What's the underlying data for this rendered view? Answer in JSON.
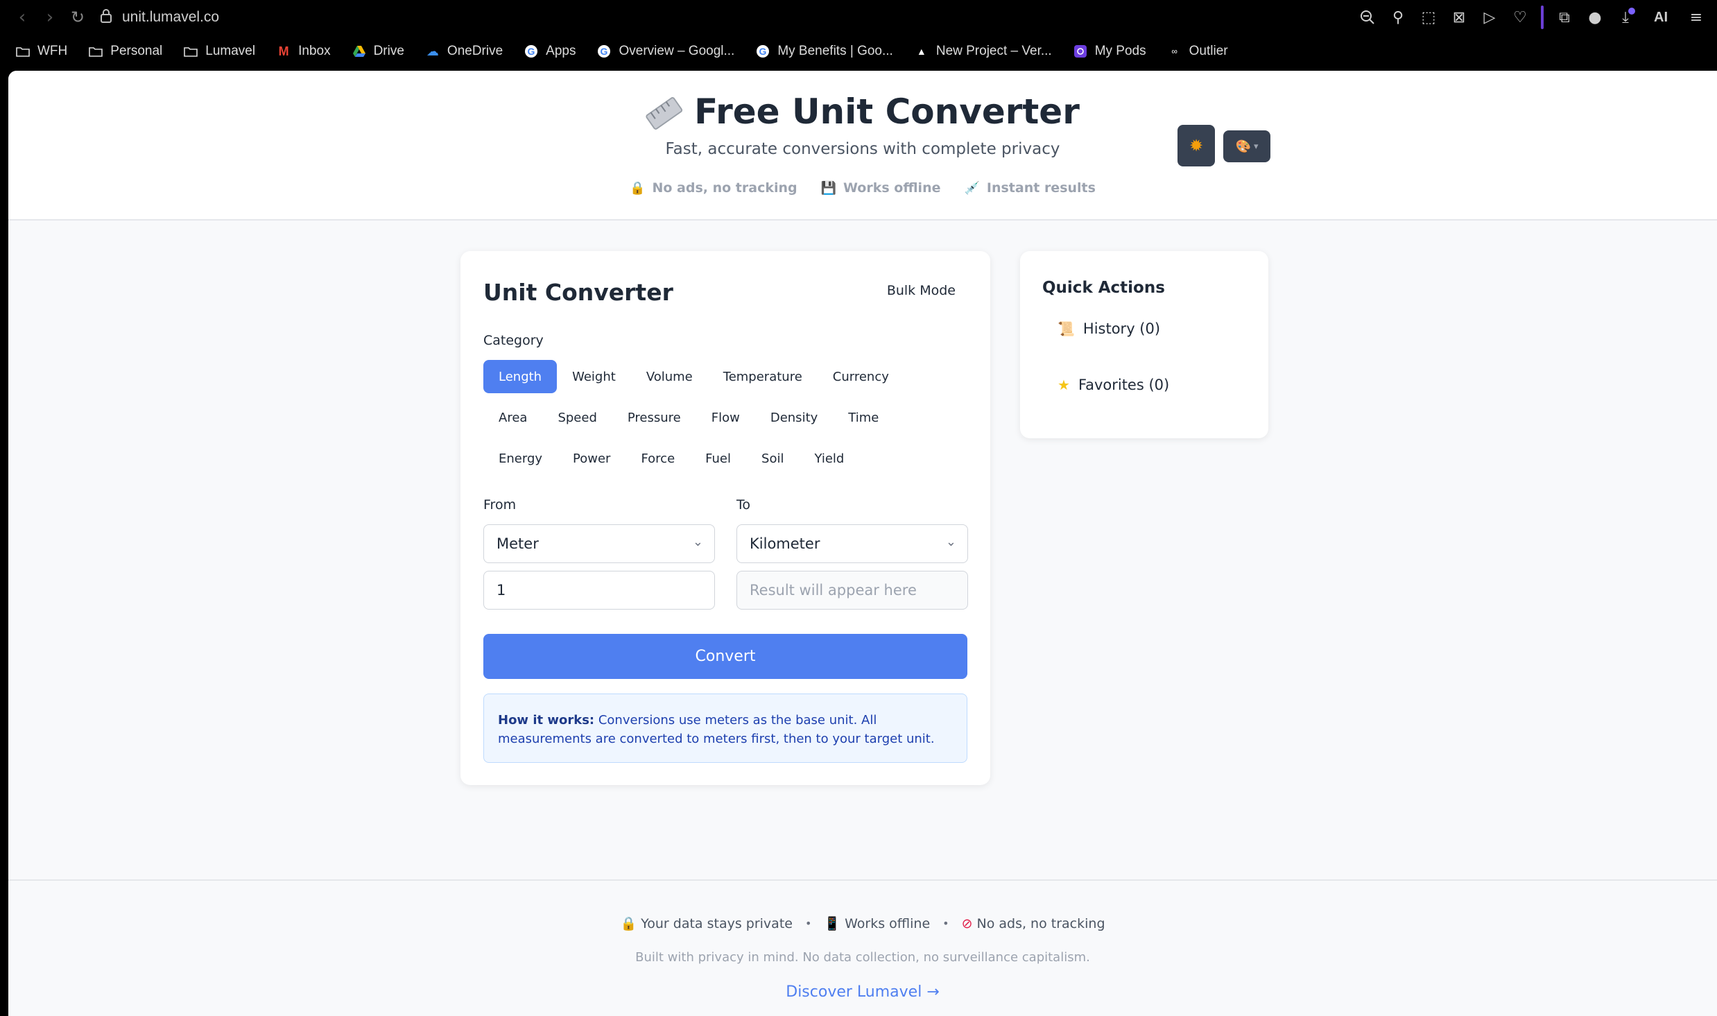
{
  "browser": {
    "url": "unit.lumavel.co",
    "ai_label": "AI"
  },
  "bookmarks": [
    {
      "label": "WFH",
      "icon": "folder-icon"
    },
    {
      "label": "Personal",
      "icon": "folder-icon"
    },
    {
      "label": "Lumavel",
      "icon": "folder-icon"
    },
    {
      "label": "Inbox",
      "icon": "gmail-icon"
    },
    {
      "label": "Drive",
      "icon": "drive-icon"
    },
    {
      "label": "OneDrive",
      "icon": "onedrive-icon"
    },
    {
      "label": "Apps",
      "icon": "google-icon"
    },
    {
      "label": "Overview – Googl...",
      "icon": "google-icon"
    },
    {
      "label": "My Benefits | Goo...",
      "icon": "google-icon"
    },
    {
      "label": "New Project – Ver...",
      "icon": "vercel-icon"
    },
    {
      "label": "My Pods",
      "icon": "pods-icon"
    },
    {
      "label": "Outlier",
      "icon": "outlier-icon"
    }
  ],
  "header": {
    "title": "Free Unit Converter",
    "subtitle": "Fast, accurate conversions with complete privacy",
    "features": [
      "No ads, no tracking",
      "Works offline",
      "Instant results"
    ]
  },
  "converter": {
    "title": "Unit Converter",
    "bulk_mode": "Bulk Mode",
    "category_label": "Category",
    "categories_row1": [
      "Length",
      "Weight",
      "Volume",
      "Temperature",
      "Currency"
    ],
    "categories_row2": [
      "Area",
      "Speed",
      "Pressure",
      "Flow",
      "Density",
      "Time"
    ],
    "categories_row3": [
      "Energy",
      "Power",
      "Force",
      "Fuel",
      "Soil",
      "Yield"
    ],
    "active_category": "Length",
    "from_label": "From",
    "to_label": "To",
    "from_unit": "Meter",
    "to_unit": "Kilometer",
    "input_value": "1",
    "result_placeholder": "Result will appear here",
    "convert_label": "Convert",
    "info_bold": "How it works:",
    "info_text": " Conversions use meters as the base unit. All measurements are converted to meters first, then to your target unit."
  },
  "quick_actions": {
    "title": "Quick Actions",
    "history": "History (0)",
    "favorites": "Favorites (0)"
  },
  "footer": {
    "item1": "Your data stays private",
    "item2": "Works offline",
    "item3": "No ads, no tracking",
    "bullet": "•",
    "note": "Built with privacy in mind. No data collection, no surveillance capitalism.",
    "link": "Discover Lumavel →"
  },
  "colors": {
    "accent": "#4f7ff0",
    "dark_button": "#374151"
  }
}
